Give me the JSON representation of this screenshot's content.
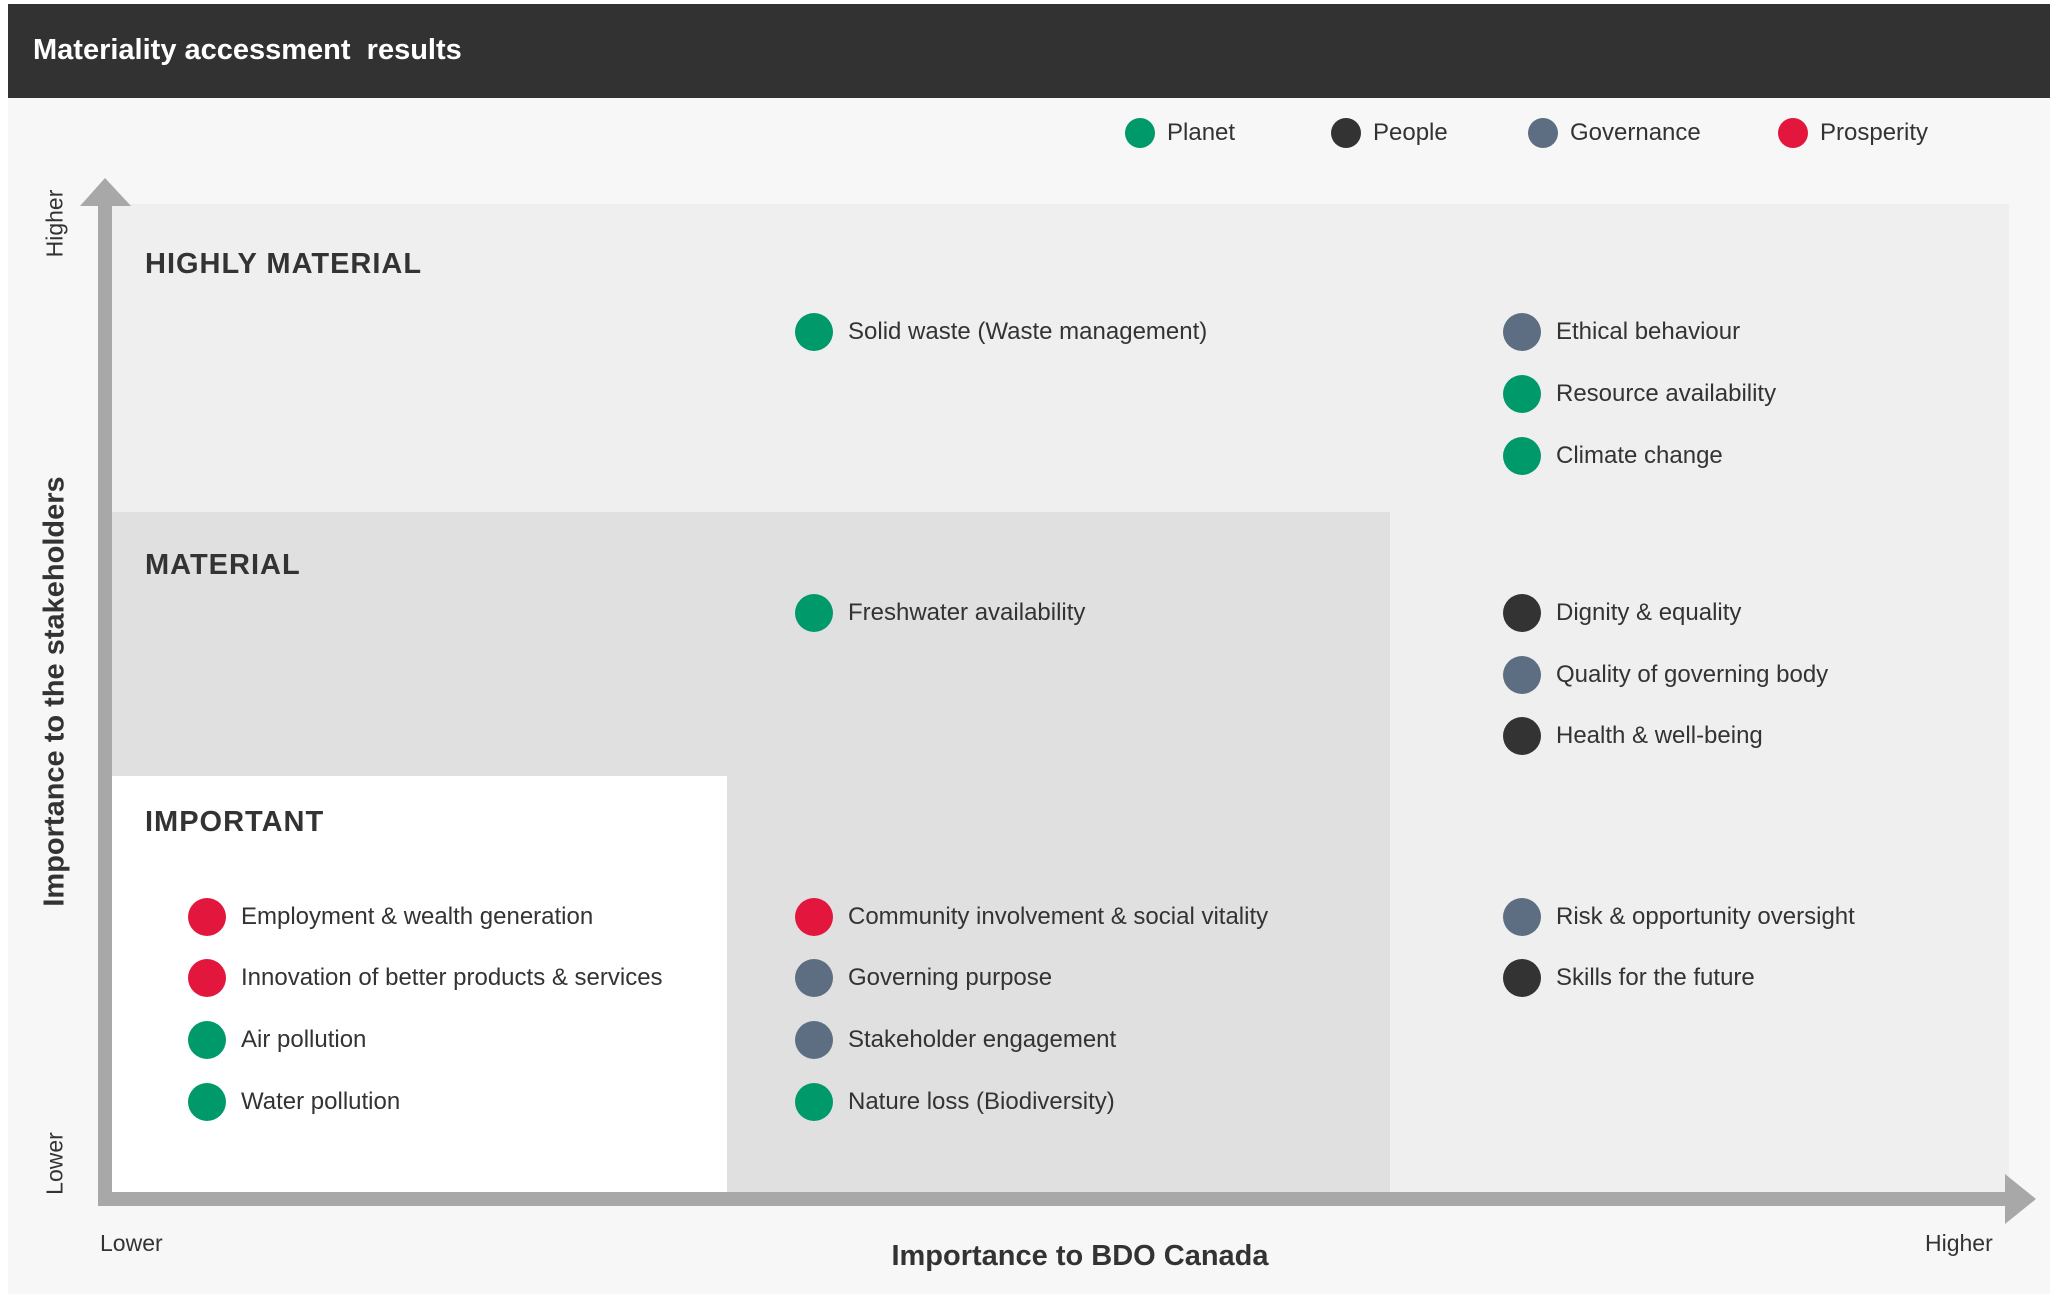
{
  "header": {
    "title": "Materiality accessment  results"
  },
  "legend": [
    {
      "name": "Planet",
      "color": "#009a6a"
    },
    {
      "name": "People",
      "color": "#333333"
    },
    {
      "name": "Governance",
      "color": "#5d6e83"
    },
    {
      "name": "Prosperity",
      "color": "#e3173e"
    }
  ],
  "chart_data": {
    "type": "scatter",
    "title": "Materiality accessment  results",
    "xlabel": "Importance to BDO Canada",
    "ylabel": "Importance to the stakeholders",
    "x_tick_labels": [
      "Lower",
      "Higher"
    ],
    "y_tick_labels": [
      "Lower",
      "Higher"
    ],
    "zones": [
      "HIGHLY MATERIAL",
      "MATERIAL",
      "IMPORTANT"
    ],
    "categories": {
      "Planet": "#009a6a",
      "People": "#333333",
      "Governance": "#5d6e83",
      "Prosperity": "#e3173e"
    },
    "topics": [
      {
        "label": "Solid waste (Waste management)",
        "category": "Planet",
        "zone": "HIGHLY MATERIAL"
      },
      {
        "label": "Ethical behaviour",
        "category": "Governance",
        "zone": "HIGHLY MATERIAL"
      },
      {
        "label": "Resource availability",
        "category": "Planet",
        "zone": "HIGHLY MATERIAL"
      },
      {
        "label": "Climate change",
        "category": "Planet",
        "zone": "HIGHLY MATERIAL"
      },
      {
        "label": "Freshwater availability",
        "category": "Planet",
        "zone": "MATERIAL"
      },
      {
        "label": "Dignity & equality",
        "category": "People",
        "zone": "HIGHLY MATERIAL"
      },
      {
        "label": "Quality of governing body",
        "category": "Governance",
        "zone": "HIGHLY MATERIAL"
      },
      {
        "label": "Health & well-being",
        "category": "People",
        "zone": "HIGHLY MATERIAL"
      },
      {
        "label": "Employment & wealth generation",
        "category": "Prosperity",
        "zone": "IMPORTANT"
      },
      {
        "label": "Innovation of better products & services",
        "category": "Prosperity",
        "zone": "IMPORTANT"
      },
      {
        "label": "Air pollution",
        "category": "Planet",
        "zone": "IMPORTANT"
      },
      {
        "label": "Water pollution",
        "category": "Planet",
        "zone": "IMPORTANT"
      },
      {
        "label": "Community involvement & social vitality",
        "category": "Prosperity",
        "zone": "MATERIAL"
      },
      {
        "label": "Governing purpose",
        "category": "Governance",
        "zone": "MATERIAL"
      },
      {
        "label": "Stakeholder engagement",
        "category": "Governance",
        "zone": "MATERIAL"
      },
      {
        "label": "Nature loss (Biodiversity)",
        "category": "Planet",
        "zone": "MATERIAL"
      },
      {
        "label": "Risk & opportunity oversight",
        "category": "Governance",
        "zone": "HIGHLY MATERIAL"
      },
      {
        "label": "Skills for the future",
        "category": "People",
        "zone": "HIGHLY MATERIAL"
      }
    ]
  }
}
